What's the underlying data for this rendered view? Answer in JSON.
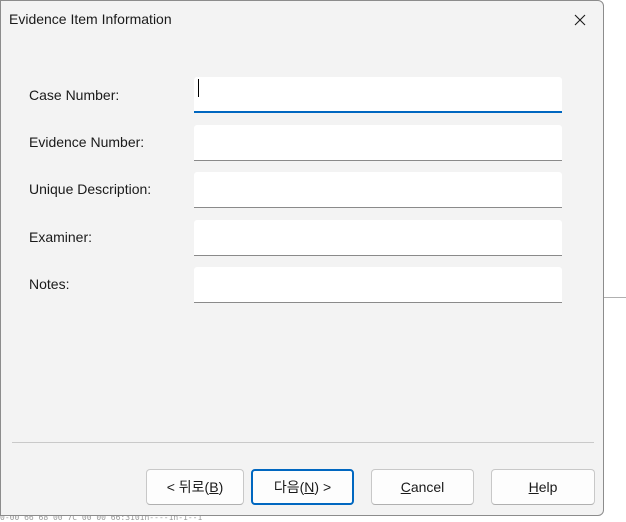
{
  "background": {
    "hex_dump_fragment": "0-00 66 68 00 7C 00 00 66:3101n----1n-1--1"
  },
  "dialog": {
    "title": "Evidence Item Information",
    "close_glyph": "close-icon"
  },
  "form": {
    "fields": [
      {
        "label": "Case Number:",
        "value": "",
        "focused": true
      },
      {
        "label": "Evidence Number:",
        "value": ""
      },
      {
        "label": "Unique Description:",
        "value": ""
      },
      {
        "label": "Examiner:",
        "value": ""
      },
      {
        "label": "Notes:",
        "value": ""
      }
    ]
  },
  "buttons": {
    "back": {
      "prefix": "< 뒤로(",
      "key": "B",
      "suffix": ")"
    },
    "next": {
      "prefix": "다음(",
      "key": "N",
      "suffix": ") >"
    },
    "cancel": {
      "prefix": "",
      "key": "C",
      "suffix": "ancel"
    },
    "help": {
      "prefix": "",
      "key": "H",
      "suffix": "elp"
    }
  },
  "colors": {
    "accent": "#0067c0",
    "dialog_bg": "#f3f3f3",
    "input_bg": "#ffffff"
  }
}
